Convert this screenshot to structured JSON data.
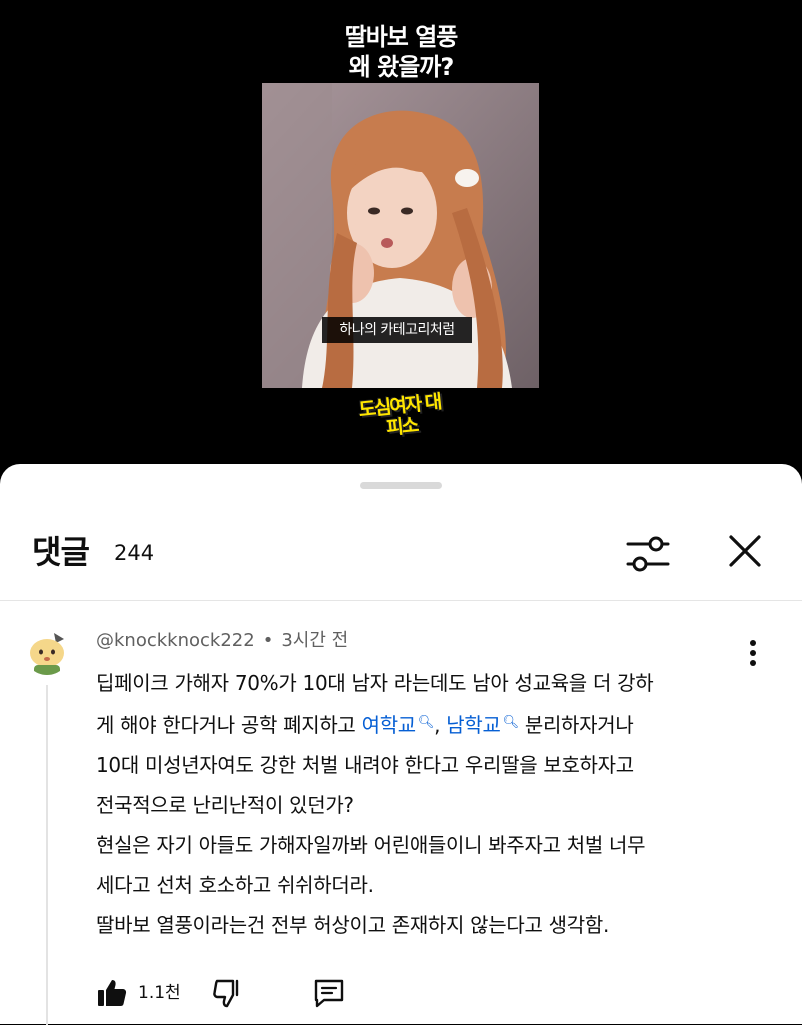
{
  "video": {
    "title_line1": "딸바보 열풍",
    "title_line2": "왜 왔을까?",
    "subtitle": "하나의 카테고리처럼",
    "channel_logo": "도심여자 대피소",
    "colors": {
      "logo": "#ffe600",
      "background": "#000000"
    }
  },
  "comments_panel": {
    "title": "댓글",
    "count": "244",
    "icons": {
      "filter": "sliders-icon",
      "close": "close-icon"
    }
  },
  "comment": {
    "author": "@knockknock222",
    "time": "3시간 전",
    "body": {
      "line1": "딥페이크 가해자 70%가 10대 남자 라는데도 남아 성교육을 더 강하",
      "line2_prefix": "게 해야 한다거나 공학 폐지하고 ",
      "tag1": "여학교",
      "comma": ", ",
      "tag2": "남학교",
      "line2_suffix": " 분리하자거나",
      "line3": "10대 미성년자여도 강한 처벌 내려야 한다고 우리딸을 보호하자고",
      "line4": "전국적으로 난리난적이 있던가?",
      "line5": "현실은 자기 아들도 가해자일까봐 어린애들이니 봐주자고 처벌 너무",
      "line6": "세다고 선처 호소하고 쉬쉬하더라.",
      "line7": "딸바보 열풍이라는건 전부 허상이고 존재하지 않는다고 생각함."
    },
    "like_count": "1.1천",
    "link_color": "#065fd4"
  }
}
